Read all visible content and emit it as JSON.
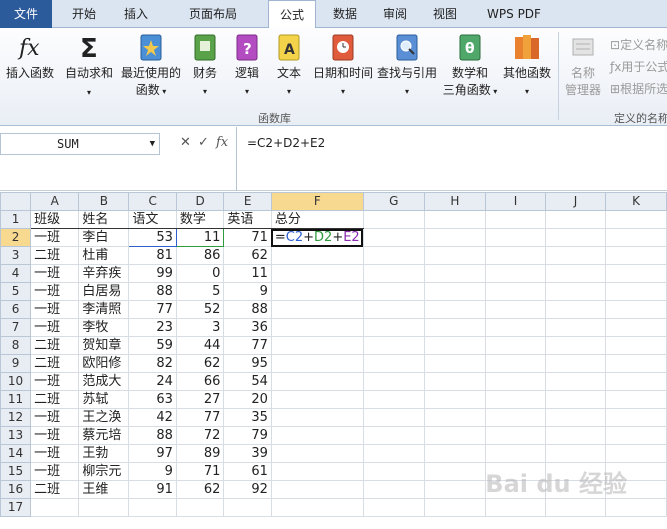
{
  "tabs": [
    "文件",
    "开始",
    "插入",
    "页面布局",
    "公式",
    "数据",
    "审阅",
    "视图",
    "WPS PDF"
  ],
  "ribbon": {
    "buttons": [
      {
        "label": "插入函数",
        "icon": "fx-icon"
      },
      {
        "label": "自动求和",
        "icon": "sigma-icon"
      },
      {
        "label": "最近使用的",
        "label2": "函数",
        "icon": "book-star-icon"
      },
      {
        "label": "财务",
        "icon": "book-finance-icon"
      },
      {
        "label": "逻辑",
        "icon": "book-question-icon"
      },
      {
        "label": "文本",
        "icon": "book-text-icon"
      },
      {
        "label": "日期和时间",
        "icon": "book-clock-icon"
      },
      {
        "label": "查找与引用",
        "icon": "book-search-icon"
      },
      {
        "label": "数学和",
        "label2": "三角函数",
        "icon": "book-theta-icon"
      },
      {
        "label": "其他函数",
        "icon": "books-icon"
      }
    ],
    "group_label": "函数库",
    "names": {
      "manager": "名称",
      "manager2": "管理器",
      "define": "定义名称",
      "use": "用于公式",
      "create": "根据所选",
      "group_label": "定义的名称"
    }
  },
  "formula_bar": {
    "name_box": "SUM",
    "formula": "=C2+D2+E2",
    "fx": "fx"
  },
  "columns": [
    "A",
    "B",
    "C",
    "D",
    "E",
    "F",
    "G",
    "H",
    "I",
    "J",
    "K"
  ],
  "rows": [
    {
      "n": "1",
      "a": "班级",
      "b": "姓名",
      "c": "语文",
      "d": "数学",
      "e": "英语",
      "f": "总分"
    },
    {
      "n": "2",
      "a": "一班",
      "b": "李白",
      "c": "53",
      "d": "11",
      "e": "71"
    },
    {
      "n": "3",
      "a": "二班",
      "b": "杜甫",
      "c": "81",
      "d": "86",
      "e": "62"
    },
    {
      "n": "4",
      "a": "一班",
      "b": "辛弃疾",
      "c": "99",
      "d": "0",
      "e": "11"
    },
    {
      "n": "5",
      "a": "一班",
      "b": "白居易",
      "c": "88",
      "d": "5",
      "e": "9"
    },
    {
      "n": "6",
      "a": "一班",
      "b": "李清照",
      "c": "77",
      "d": "52",
      "e": "88"
    },
    {
      "n": "7",
      "a": "一班",
      "b": "李牧",
      "c": "23",
      "d": "3",
      "e": "36"
    },
    {
      "n": "8",
      "a": "二班",
      "b": "贺知章",
      "c": "59",
      "d": "44",
      "e": "77"
    },
    {
      "n": "9",
      "a": "二班",
      "b": "欧阳修",
      "c": "82",
      "d": "62",
      "e": "95"
    },
    {
      "n": "10",
      "a": "一班",
      "b": "范成大",
      "c": "24",
      "d": "66",
      "e": "54"
    },
    {
      "n": "11",
      "a": "二班",
      "b": "苏轼",
      "c": "63",
      "d": "27",
      "e": "20"
    },
    {
      "n": "12",
      "a": "一班",
      "b": "王之涣",
      "c": "42",
      "d": "77",
      "e": "35"
    },
    {
      "n": "13",
      "a": "一班",
      "b": "蔡元培",
      "c": "88",
      "d": "72",
      "e": "79"
    },
    {
      "n": "14",
      "a": "一班",
      "b": "王勃",
      "c": "97",
      "d": "89",
      "e": "39"
    },
    {
      "n": "15",
      "a": "一班",
      "b": "柳宗元",
      "c": "9",
      "d": "71",
      "e": "61"
    },
    {
      "n": "16",
      "a": "二班",
      "b": "王维",
      "c": "91",
      "d": "62",
      "e": "92"
    },
    {
      "n": "17",
      "a": "",
      "b": "",
      "c": "",
      "d": "",
      "e": ""
    }
  ],
  "active_formula_parts": [
    "=",
    "C2",
    "+",
    "D2",
    "+",
    "E2"
  ],
  "watermark": "Bai du 经验"
}
